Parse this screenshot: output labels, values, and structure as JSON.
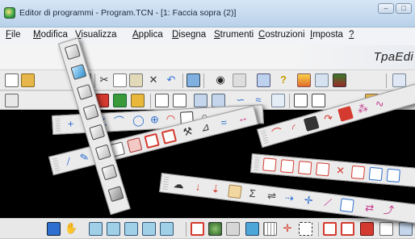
{
  "window": {
    "title": "Editor di programmi - Program.TCN - [1: Faccia sopra (2)]",
    "controls": {
      "minimize": "–",
      "maximize": "□",
      "close": "×"
    }
  },
  "menu": [
    {
      "label": "File",
      "key": "F",
      "rest": "ile"
    },
    {
      "label": "Modifica",
      "key": "M",
      "rest": "odifica"
    },
    {
      "label": "Visualizza",
      "key": "V",
      "rest": "isualizza"
    },
    {
      "label": "Applica",
      "key": "A",
      "rest": "pplica"
    },
    {
      "label": "Disegna",
      "key": "D",
      "rest": "isegna"
    },
    {
      "label": "Strumenti",
      "key": "S",
      "rest": "trumenti"
    },
    {
      "label": "Costruzioni",
      "key": "C",
      "rest": "ostruzioni"
    },
    {
      "label": "Imposta",
      "key": "I",
      "rest": "mposta"
    },
    {
      "label": "?",
      "key": "?",
      "rest": ""
    }
  ],
  "brand": "TpaEdi",
  "toolbar_icons": {
    "new": "new-document-icon",
    "open": "open-folder-icon",
    "save": "save-icon",
    "print": "print-icon",
    "cut": "cut-icon",
    "copy": "copy-icon",
    "paste": "paste-icon",
    "delete": "delete-icon",
    "undo": "undo-icon",
    "find": "binoculars-icon",
    "help": "help-icon"
  },
  "colors": {
    "canvas": "#000000",
    "toolbar": "#ececec",
    "titlebar": "#c8dbef",
    "accent_red": "#d43a2f",
    "accent_blue": "#2f6fcf",
    "accent_green": "#3a9a3a"
  }
}
